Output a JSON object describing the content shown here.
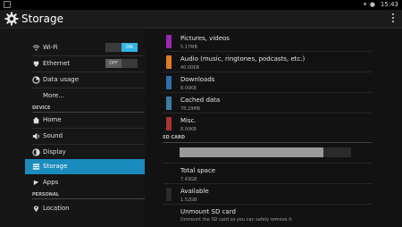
{
  "status_bar": {
    "time": "15:43"
  },
  "header": {
    "title": "Storage"
  },
  "sidebar": {
    "items": [
      {
        "label": "Wi-Fi",
        "icon": "wifi-icon",
        "toggle": "ON"
      },
      {
        "label": "Ethernet",
        "icon": "ethernet-icon",
        "toggle": "OFF"
      },
      {
        "label": "Data usage",
        "icon": "data-usage-icon"
      },
      {
        "label": "More..."
      }
    ],
    "device_header": "DEVICE",
    "device_items": [
      {
        "label": "Home",
        "icon": "home-icon"
      },
      {
        "label": "Sound",
        "icon": "sound-icon"
      },
      {
        "label": "Display",
        "icon": "display-icon"
      },
      {
        "label": "Storage",
        "icon": "storage-icon"
      },
      {
        "label": "Apps",
        "icon": "apps-icon"
      }
    ],
    "personal_header": "PERSONAL",
    "personal_items": [
      {
        "label": "Location",
        "icon": "location-icon"
      }
    ]
  },
  "storage": {
    "items": [
      {
        "name": "Pictures, videos",
        "size": "5.17MB",
        "color": "#9c27b0"
      },
      {
        "name": "Audio (music, ringtones, podcasts, etc.)",
        "size": "40.00KB",
        "color": "#e07b25"
      },
      {
        "name": "Downloads",
        "size": "8.00KB",
        "color": "#2f6fa8"
      },
      {
        "name": "Cached data",
        "size": "78.29MB",
        "color": "#3a7ca5"
      },
      {
        "name": "Misc.",
        "size": "8.00KB",
        "color": "#a83232"
      }
    ],
    "sd_header": "SD CARD",
    "sd_usage_fraction": 0.84,
    "total_space": {
      "name": "Total space",
      "size": "7.43GB"
    },
    "available": {
      "name": "Available",
      "size": "1.52GB"
    },
    "unmount": {
      "name": "Unmount SD card",
      "sub": "Unmount the SD card so you can safely remove it"
    }
  }
}
